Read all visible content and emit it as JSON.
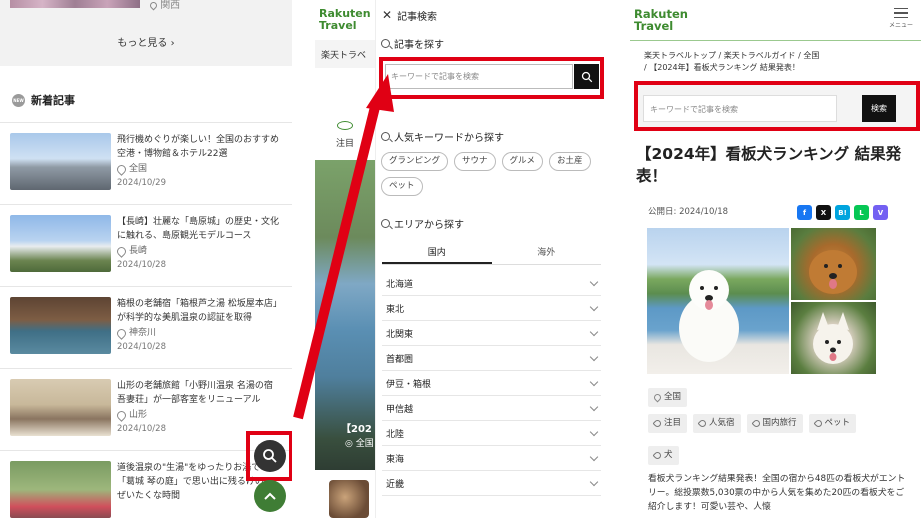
{
  "panel1": {
    "top_location": "関西",
    "more_label": "もっと見る ›",
    "section_badge": "NEW",
    "section_title": "新着記事",
    "articles": [
      {
        "title": "飛行機めぐりが楽しい！全国のおすすめ空港・博物館＆ホテル22選",
        "location": "全国",
        "date": "2024/10/29"
      },
      {
        "title": "【長崎】壮麗な「島原城」の歴史・文化に触れる、島原観光モデルコース",
        "location": "長崎",
        "date": "2024/10/28"
      },
      {
        "title": "箱根の老舗宿「箱根芦之湯 松坂屋本店」が科学的な美肌温泉の認証を取得",
        "location": "神奈川",
        "date": "2024/10/28"
      },
      {
        "title": "山形の老舗旅館「小野川温泉 名湯の宿 吾妻荘」が一部客室をリニューアル",
        "location": "山形",
        "date": "2024/10/28"
      },
      {
        "title": "道後温泉の\"生湯\"をゆったりお湯で「葛城 琴の庭」で思い出に残るけのぜいたくな時間",
        "location": "",
        "date": ""
      }
    ]
  },
  "panel2": {
    "logo_line1": "Rakuten",
    "logo_line2": "Travel",
    "strip_text": "楽天トラベ",
    "nav_label": "注目",
    "photo_caption": "【202",
    "photo_caption2": "◎ 全国"
  },
  "search_panel": {
    "header_title": "記事検索",
    "keyword_section": "記事を探す",
    "input_placeholder": "キーワードで記事を検索",
    "popular_section": "人気キーワードから探す",
    "keywords": [
      "グランピング",
      "サウナ",
      "グルメ",
      "お土産",
      "ペット"
    ],
    "area_section": "エリアから探す",
    "tabs": [
      "国内",
      "海外"
    ],
    "regions": [
      "北海道",
      "東北",
      "北関東",
      "首都圏",
      "伊豆・箱根",
      "甲信越",
      "北陸",
      "東海",
      "近畿"
    ]
  },
  "panel3": {
    "logo_line1": "Rakuten",
    "logo_line2": "Travel",
    "menu_label": "メニュー",
    "breadcrumb": [
      "楽天トラベルトップ",
      "楽天トラベルガイド",
      "全国",
      "【2024年】看板犬ランキング 結果発表！"
    ],
    "search_placeholder": "キーワードで記事を検索",
    "search_button": "検索",
    "article_title": "【2024年】看板犬ランキング 結果発表！",
    "published": "公開日: 2024/10/18",
    "share_icons": [
      "f",
      "X",
      "B!",
      "L",
      "V"
    ],
    "location_tag": "全国",
    "tags": [
      "注目",
      "人気宿",
      "国内旅行",
      "ペット"
    ],
    "tag_dog": "犬",
    "body_text": "看板犬ランキング結果発表！全国の宿から48匹の看板犬がエントリー。総投票数5,030票の中から人気を集めた20匹の看板犬をご紹介します！可愛い芸や、人懐"
  },
  "colors": {
    "highlight_red": "#e00014",
    "rakuten_green": "#3e8b30",
    "fab_dark": "#333333"
  }
}
